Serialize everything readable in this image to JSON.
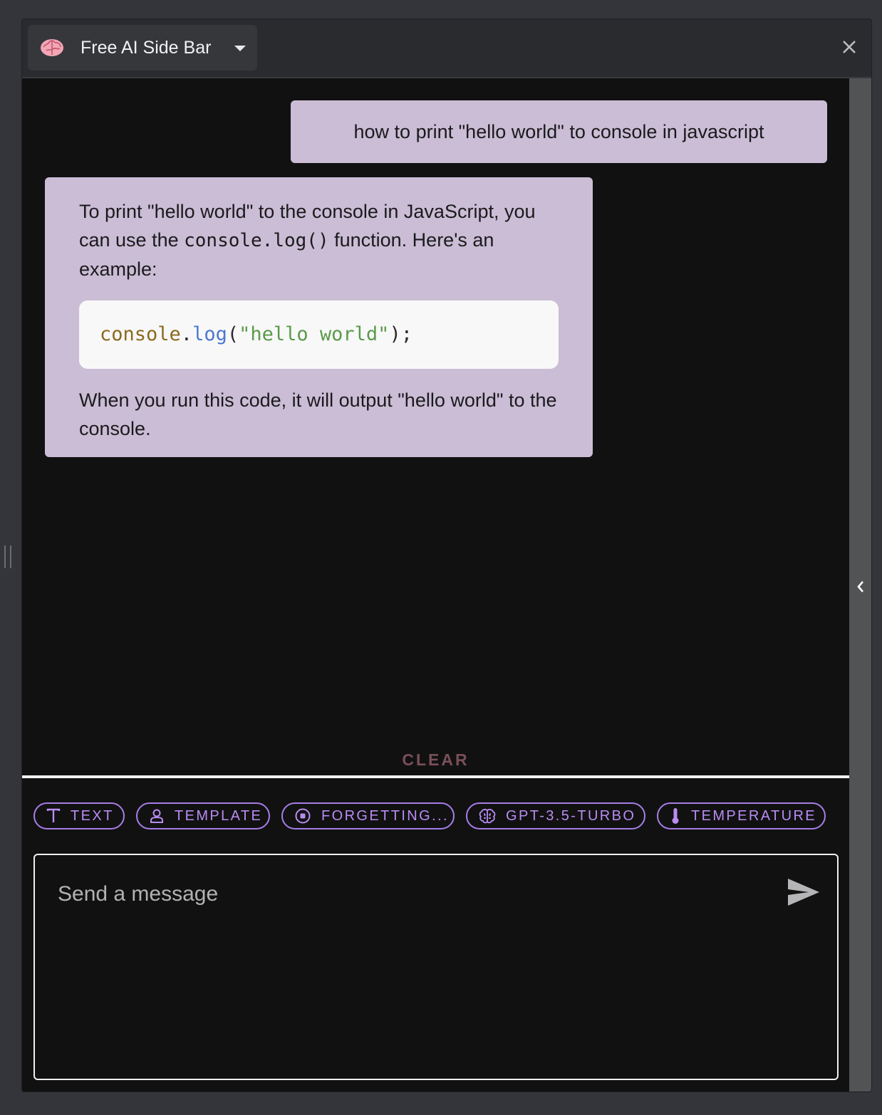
{
  "header": {
    "app_title": "Free AI Side Bar",
    "app_icon": "brain-icon",
    "dropdown_icon": "caret-down-icon",
    "close_icon": "close-icon"
  },
  "chat": {
    "user_message": "how to print \"hello world\" to console in javascript",
    "ai_message": {
      "intro_part1": "To print \"hello world\" to the console in JavaScript, you can use the ",
      "intro_code": "console.log()",
      "intro_part2": " function. Here's an example:",
      "code": {
        "object": "console",
        "dot": ".",
        "method": "log",
        "open_paren": "(",
        "string": "\"hello world\"",
        "close": ");"
      },
      "outro": "When you run this code, it will output \"hello world\" to the console."
    },
    "clear_label": "CLEAR"
  },
  "toolbar": {
    "chips": [
      {
        "label": "TEXT",
        "icon": "text-icon"
      },
      {
        "label": "TEMPLATE",
        "icon": "person-icon"
      },
      {
        "label": "FORGETTING...",
        "icon": "stop-circle-icon"
      },
      {
        "label": "GPT-3.5-TURBO",
        "icon": "brain-icon"
      },
      {
        "label": "TEMPERATURE",
        "icon": "thermometer-icon"
      }
    ]
  },
  "composer": {
    "placeholder": "Send a message",
    "value": "",
    "send_icon": "send-icon"
  },
  "colors": {
    "bubble": "#cabdd5",
    "chip_accent": "#a67ee6",
    "clear": "#7a4f58",
    "code_object": "#8b6a1e",
    "code_method": "#4a78d0",
    "code_string": "#5a9a4a"
  }
}
